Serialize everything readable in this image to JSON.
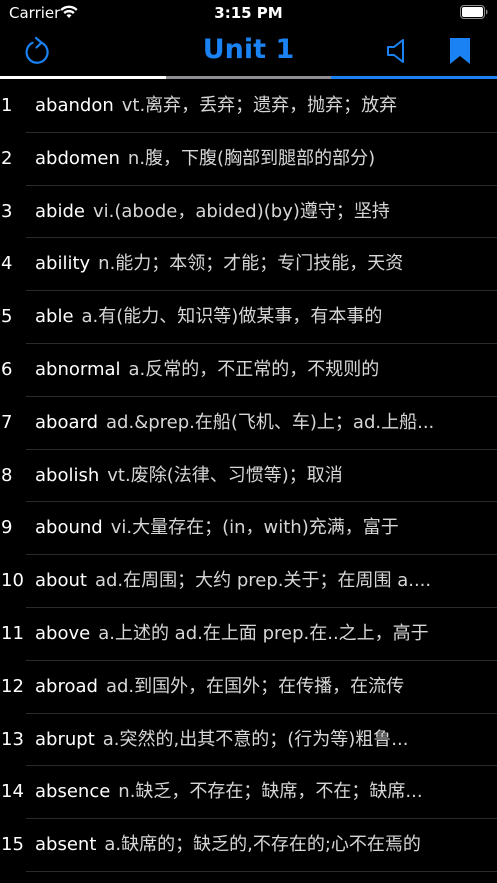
{
  "status": {
    "carrier": "Carrier",
    "time": "3:15 PM"
  },
  "nav": {
    "title": "Unit 1"
  },
  "colors": {
    "accent": "#1a82f2",
    "background": "#000000",
    "tab_active": "#ffffff",
    "tab_mid": "#8e8e93"
  },
  "icons": {
    "refresh": "refresh-icon",
    "speaker": "speaker-icon",
    "bookmark": "bookmark-icon"
  },
  "words": [
    {
      "index": "1",
      "word": "abandon",
      "definition": "vt.离弃，丢弃；遗弃，抛弃；放弃"
    },
    {
      "index": "2",
      "word": "abdomen",
      "definition": "n.腹，下腹(胸部到腿部的部分)"
    },
    {
      "index": "3",
      "word": "abide",
      "definition": "vi.(abode，abided)(by)遵守；坚持"
    },
    {
      "index": "4",
      "word": "ability",
      "definition": "n.能力；本领；才能；专门技能，天资"
    },
    {
      "index": "5",
      "word": "able",
      "definition": "a.有(能力、知识等)做某事，有本事的"
    },
    {
      "index": "6",
      "word": "abnormal",
      "definition": "a.反常的，不正常的，不规则的"
    },
    {
      "index": "7",
      "word": "aboard",
      "definition": "ad.&prep.在船(飞机、车)上；ad.上船..."
    },
    {
      "index": "8",
      "word": "abolish",
      "definition": "vt.废除(法律、习惯等)；取消"
    },
    {
      "index": "9",
      "word": "abound",
      "definition": "vi.大量存在；(in，with)充满，富于"
    },
    {
      "index": "10",
      "word": "about",
      "definition": "ad.在周围；大约 prep.关于；在周围 a...."
    },
    {
      "index": "11",
      "word": "above",
      "definition": "a.上述的 ad.在上面  prep.在..之上，高于"
    },
    {
      "index": "12",
      "word": "abroad",
      "definition": "ad.到国外，在国外；在传播，在流传"
    },
    {
      "index": "13",
      "word": "abrupt",
      "definition": "a.突然的,出其不意的；(行为等)粗鲁..."
    },
    {
      "index": "14",
      "word": "absence",
      "definition": "n.缺乏，不存在；缺席，不在；缺席..."
    },
    {
      "index": "15",
      "word": "absent",
      "definition": "a.缺席的；缺乏的,不存在的;心不在焉的"
    }
  ]
}
